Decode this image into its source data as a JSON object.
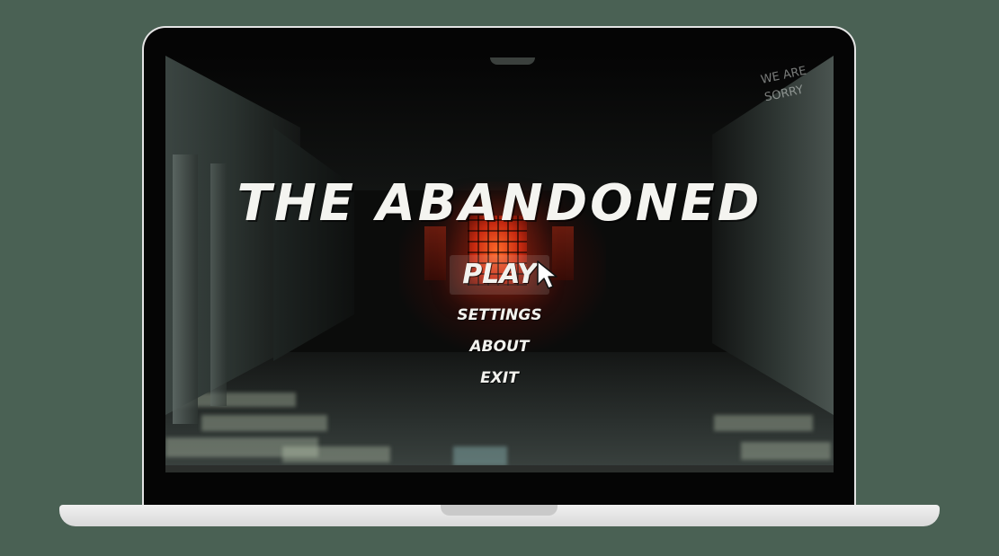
{
  "game": {
    "title": "THE ABANDONED",
    "menu": {
      "play": "PLAY",
      "settings": "SETTINGS",
      "about": "ABOUT",
      "exit": "EXIT"
    },
    "graffiti": "WE ARE SORRY"
  },
  "colors": {
    "background": "#4a6154",
    "laptop_frame": "#e4e4e4",
    "menu_text": "#f2f2ee",
    "window_glow": "#ff6a2a"
  }
}
